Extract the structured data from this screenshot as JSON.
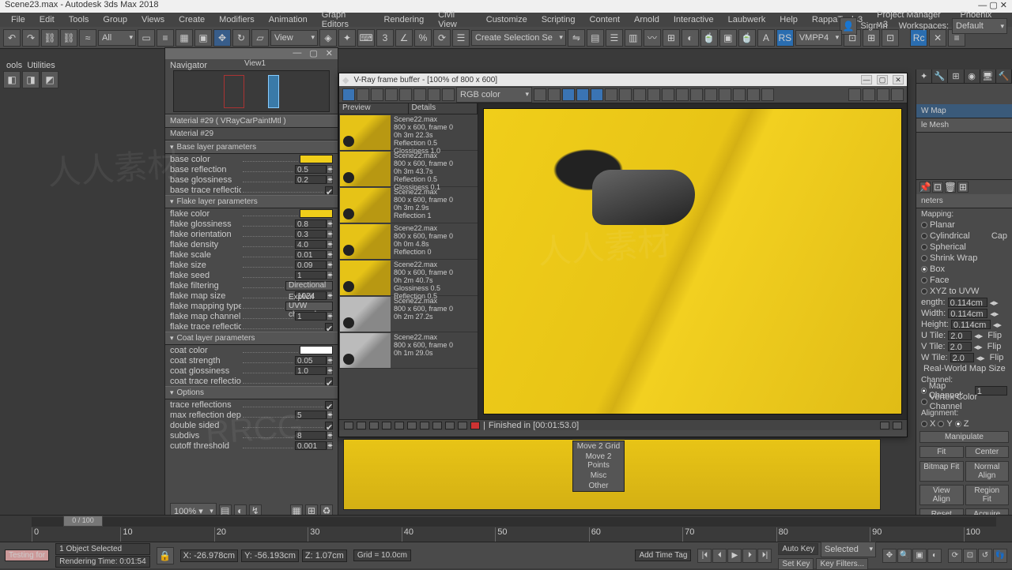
{
  "title": "Scene23.max - Autodesk 3ds Max 2018",
  "menu": [
    "File",
    "Edit",
    "Tools",
    "Group",
    "Views",
    "Create",
    "Modifiers",
    "Animation",
    "Graph Editors",
    "Rendering",
    "Civil View",
    "Customize",
    "Scripting",
    "Content",
    "Arnold",
    "Interactive",
    "Laubwerk",
    "Help",
    "RappaTools3",
    "Project Manager v.3",
    "Phoenix FD"
  ],
  "signin": "Sign In",
  "workspace_lbl": "Workspaces:",
  "workspace_val": "Default",
  "toolbar": {
    "all": "All",
    "view": "View"
  },
  "utilities": "Utilities",
  "viewport1": "View1",
  "navigator": "Navigator",
  "material": {
    "title": "Material #29  ( VRayCarPaintMtl )",
    "name": "Material #29",
    "sections": {
      "base": "Base layer parameters",
      "flake": "Flake layer parameters",
      "coat": "Coat layer parameters",
      "options": "Options"
    },
    "base_params": [
      {
        "n": "base color",
        "type": "color",
        "c": "#f0ce1a"
      },
      {
        "n": "base reflection",
        "v": "0.5"
      },
      {
        "n": "base glossiness",
        "v": "0.2"
      },
      {
        "n": "base trace reflections",
        "type": "check"
      }
    ],
    "flake_params": [
      {
        "n": "flake color",
        "type": "color",
        "c": "#f0ce1a"
      },
      {
        "n": "flake glossiness",
        "v": "0.8"
      },
      {
        "n": "flake orientation",
        "v": "0.3"
      },
      {
        "n": "flake density",
        "v": "4.0"
      },
      {
        "n": "flake scale",
        "v": "0.01"
      },
      {
        "n": "flake size",
        "v": "0.09"
      },
      {
        "n": "flake seed",
        "v": "1"
      },
      {
        "n": "flake filtering",
        "type": "drop",
        "v": "Directional"
      },
      {
        "n": "flake map size",
        "v": "1024"
      },
      {
        "n": "flake mapping type",
        "type": "drop",
        "v": "Explicit UVW channel"
      },
      {
        "n": "flake map channel",
        "v": "1"
      },
      {
        "n": "flake trace reflections",
        "type": "check"
      }
    ],
    "coat_params": [
      {
        "n": "coat color",
        "type": "color",
        "c": "#ffffff"
      },
      {
        "n": "coat strength",
        "v": "0.05"
      },
      {
        "n": "coat glossiness",
        "v": "1.0"
      },
      {
        "n": "coat trace reflections",
        "type": "check"
      }
    ],
    "option_params": [
      {
        "n": "trace reflections",
        "type": "check"
      },
      {
        "n": "max reflection depth",
        "v": "5"
      },
      {
        "n": "double sided",
        "type": "check"
      },
      {
        "n": "subdivs",
        "v": "8"
      },
      {
        "n": "cutoff threshold",
        "v": "0.001"
      }
    ]
  },
  "mat_footer": "100% ▾",
  "vfb": {
    "title": "V-Ray frame buffer - [100% of 800 x 600]",
    "channel": "RGB color",
    "history_hdr": [
      "Preview",
      "Details"
    ],
    "history": [
      {
        "l1": "Scene22.max",
        "l2": "800 x 600, frame 0",
        "l3": "0h 3m 22.3s",
        "l4": "Reflection 0.5",
        "l5": "Glossiness 1.0"
      },
      {
        "l1": "Scene22.max",
        "l2": "800 x 600, frame 0",
        "l3": "0h 3m 43.7s",
        "l4": "Reflection 0.5",
        "l5": "Glossiness 0.1"
      },
      {
        "l1": "Scene22.max",
        "l2": "800 x 600, frame 0",
        "l3": "0h 3m 2.9s",
        "l4": "Reflection 1",
        "l5": ""
      },
      {
        "l1": "Scene22.max",
        "l2": "800 x 600, frame 0",
        "l3": "0h 0m 4.8s",
        "l4": "Reflection 0",
        "l5": ""
      },
      {
        "l1": "Scene22.max",
        "l2": "800 x 600, frame 0",
        "l3": "0h 2m 40.7s",
        "l4": "Glossiness 0.5",
        "l5": "Reflection 0.5"
      },
      {
        "l1": "Scene22.max",
        "l2": "800 x 600, frame 0",
        "l3": "0h 2m 27.2s",
        "l4": "",
        "l5": "",
        "grey": true
      },
      {
        "l1": "Scene22.max",
        "l2": "800 x 600, frame 0",
        "l3": "0h 1m 29.0s",
        "l4": "",
        "l5": "",
        "grey": true
      }
    ],
    "status": "Finished in [00:01:53.0]"
  },
  "popup": [
    "Move 2 Grid",
    "Move 2 Points",
    "Misc",
    "Other"
  ],
  "right": {
    "mods": [
      "W Map",
      "le Mesh"
    ],
    "params_hdr": " neters",
    "mapping_lbl": "Mapping:",
    "mapping": [
      {
        "n": "Planar",
        "on": false
      },
      {
        "n": "Cylindrical",
        "on": false,
        "cap": "Cap"
      },
      {
        "n": "Spherical",
        "on": false
      },
      {
        "n": "Shrink Wrap",
        "on": false
      },
      {
        "n": "Box",
        "on": true
      },
      {
        "n": "Face",
        "on": false
      },
      {
        "n": "XYZ to UVW",
        "on": false
      }
    ],
    "dims": [
      {
        "n": "ength:",
        "v": "0.114cm"
      },
      {
        "n": "Width:",
        "v": "0.114cm"
      },
      {
        "n": "Height:",
        "v": "0.114cm"
      }
    ],
    "tiles": [
      {
        "n": "U Tile:",
        "v": "2.0",
        "flip": "Flip"
      },
      {
        "n": "V Tile:",
        "v": "2.0",
        "flip": "Flip"
      },
      {
        "n": "W Tile:",
        "v": "2.0",
        "flip": "Flip"
      }
    ],
    "rw": "Real-World Map Size",
    "channel": "Channel:",
    "mapch": "Map Channel:",
    "mapch_v": "1",
    "vtx": "Vertex Color Channel",
    "align": "Alignment:",
    "axes": [
      "X",
      "Y",
      "Z"
    ],
    "btns": [
      [
        "Manipulate"
      ],
      [
        "Fit",
        "Center"
      ],
      [
        "Bitmap Fit",
        "Normal Align"
      ],
      [
        "View Align",
        "Region Fit"
      ],
      [
        "Reset",
        "Acquire"
      ]
    ]
  },
  "timeline": {
    "pos": "0 / 100",
    "ticks": [
      "0",
      "10",
      "20",
      "30",
      "40",
      "50",
      "60",
      "70",
      "80",
      "90",
      "100"
    ]
  },
  "status": {
    "sel": "1 Object Selected",
    "testing": "Testing for ",
    "rtime": "Rendering Time: 0:01:54",
    "x": "X: -26.978cm",
    "y": "Y: -56.193cm",
    "z": "Z: 1.07cm",
    "grid": "Grid = 10.0cm",
    "autokey": "Auto Key",
    "selected": "Selected",
    "settime": "Set Key",
    "keyf": "Key Filters...",
    "addtime": "Add Time Tag"
  }
}
